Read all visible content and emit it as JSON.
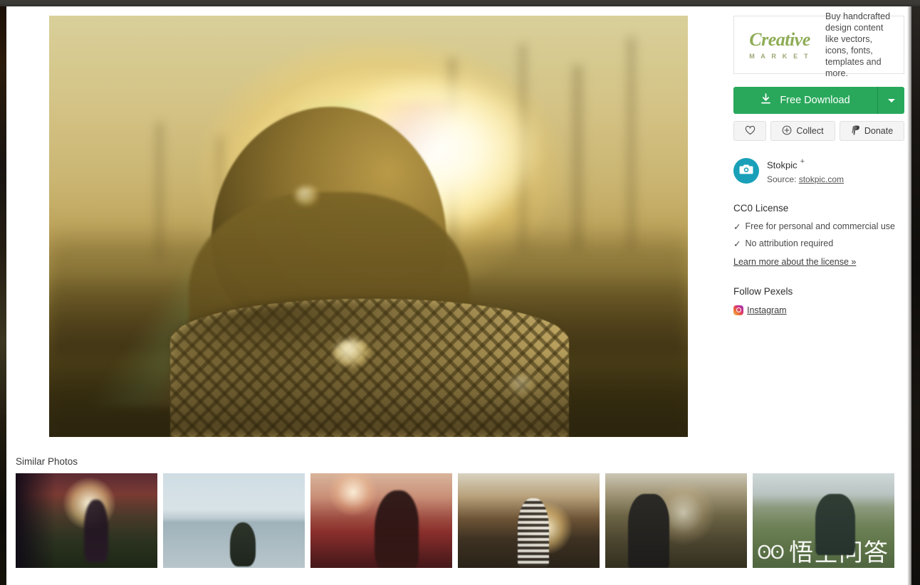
{
  "hero": {
    "alt": "Woman with long hair facing a golden sunset, wearing a patterned knit sweater"
  },
  "sidebar": {
    "promo": {
      "logo_word": "Creative",
      "logo_sub": "M A R K E T",
      "text": "Buy handcrafted design content like vectors, icons, fonts, templates and more."
    },
    "download": {
      "label": "Free Download",
      "icon": "download-icon",
      "caret_icon": "chevron-down-icon",
      "accent_color": "#29a85b"
    },
    "actions": [
      {
        "name": "like",
        "label": "",
        "icon": "heart-icon"
      },
      {
        "name": "collect",
        "label": "Collect",
        "icon": "plus-circle-icon"
      },
      {
        "name": "donate",
        "label": "Donate",
        "icon": "paypal-icon"
      }
    ],
    "author": {
      "avatar_icon": "camera-icon",
      "avatar_color": "#19a0b8",
      "name": "Stokpic",
      "follow_symbol": "+",
      "source_label": "Source:",
      "source_link": "stokpic.com"
    },
    "license": {
      "title": "CC0 License",
      "items": [
        {
          "tick": "✓",
          "text": "Free for personal and commercial use"
        },
        {
          "tick": "✓",
          "text": "No attribution required"
        }
      ],
      "more_link": "Learn more about the license »"
    },
    "follow": {
      "title": "Follow Pexels",
      "links": [
        {
          "label": "Instagram",
          "icon": "instagram-icon"
        }
      ]
    }
  },
  "similar": {
    "title": "Similar Photos",
    "thumbs": [
      {
        "id": "t1",
        "alt": "Person in sunlit field at sunset with lens flare"
      },
      {
        "id": "t2",
        "alt": "Dark haired person looking at a calm lake under pale sky"
      },
      {
        "id": "t3",
        "alt": "Woman in profile in a red field at dusk"
      },
      {
        "id": "t4",
        "alt": "Person in striped shirt on a bridge facing the sun"
      },
      {
        "id": "t5",
        "alt": "Person walking along a tree lined road at golden hour"
      },
      {
        "id": "t6",
        "alt": "Person with arms raised in a green field before mountains"
      }
    ]
  },
  "watermark": {
    "mark": "ʘʘ",
    "text": "悟空问答"
  }
}
